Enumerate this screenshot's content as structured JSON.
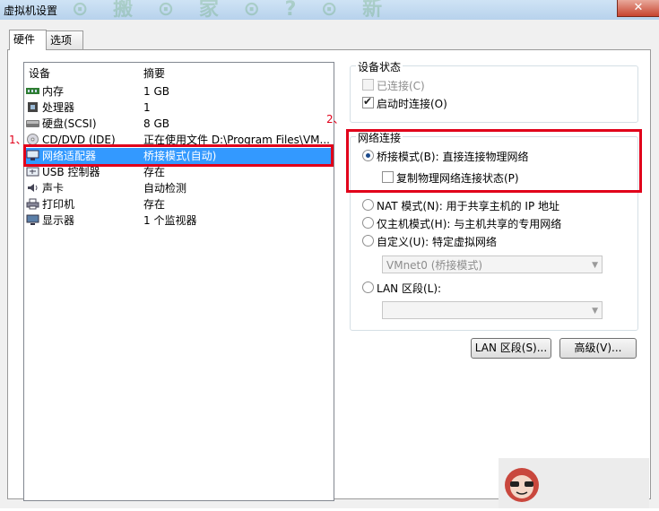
{
  "window": {
    "title": "虚拟机设置",
    "close": "✕",
    "watermark": "⊙ 搬 ⊙ 家 ⊙ ? ⊙ 新"
  },
  "tabs": [
    {
      "label": "硬件"
    },
    {
      "label": "选项"
    }
  ],
  "device_list": {
    "headers": {
      "device": "设备",
      "summary": "摘要"
    },
    "rows": [
      {
        "name": "内存",
        "summary": "1 GB",
        "icon": "memory-icon"
      },
      {
        "name": "处理器",
        "summary": "1",
        "icon": "cpu-icon"
      },
      {
        "name": "硬盘(SCSI)",
        "summary": "8 GB",
        "icon": "disk-icon"
      },
      {
        "name": "CD/DVD (IDE)",
        "summary": "正在使用文件 D:\\Program Files\\VM...",
        "icon": "cd-icon"
      },
      {
        "name": "网络适配器",
        "summary": "桥接模式(自动)",
        "icon": "network-icon",
        "selected": true
      },
      {
        "name": "USB 控制器",
        "summary": "存在",
        "icon": "usb-icon"
      },
      {
        "name": "声卡",
        "summary": "自动检测",
        "icon": "sound-icon"
      },
      {
        "name": "打印机",
        "summary": "存在",
        "icon": "printer-icon"
      },
      {
        "name": "显示器",
        "summary": "1 个监视器",
        "icon": "monitor-icon"
      }
    ]
  },
  "device_status": {
    "title": "设备状态",
    "connected": {
      "label": "已连接(C)",
      "checked": false,
      "enabled": false
    },
    "connect_on_start": {
      "label": "启动时连接(O)",
      "checked": true
    }
  },
  "network": {
    "title": "网络连接",
    "bridged": {
      "label": "桥接模式(B): 直接连接物理网络",
      "selected": true
    },
    "replicate": {
      "label": "复制物理网络连接状态(P)",
      "checked": false
    },
    "nat": {
      "label": "NAT 模式(N): 用于共享主机的 IP 地址"
    },
    "host_only": {
      "label": "仅主机模式(H): 与主机共享的专用网络"
    },
    "custom": {
      "label": "自定义(U): 特定虚拟网络"
    },
    "custom_select": {
      "value": "VMnet0 (桥接模式)"
    },
    "lan_segment": {
      "label": "LAN 区段(L):"
    },
    "lan_select": {
      "value": ""
    }
  },
  "buttons": {
    "lan_segments": "LAN 区段(S)...",
    "advanced": "高级(V)..."
  },
  "annotations": {
    "one": "1、",
    "two": "2、"
  },
  "colors": {
    "selection": "#3399ff",
    "annotation_red": "#e1001a"
  }
}
